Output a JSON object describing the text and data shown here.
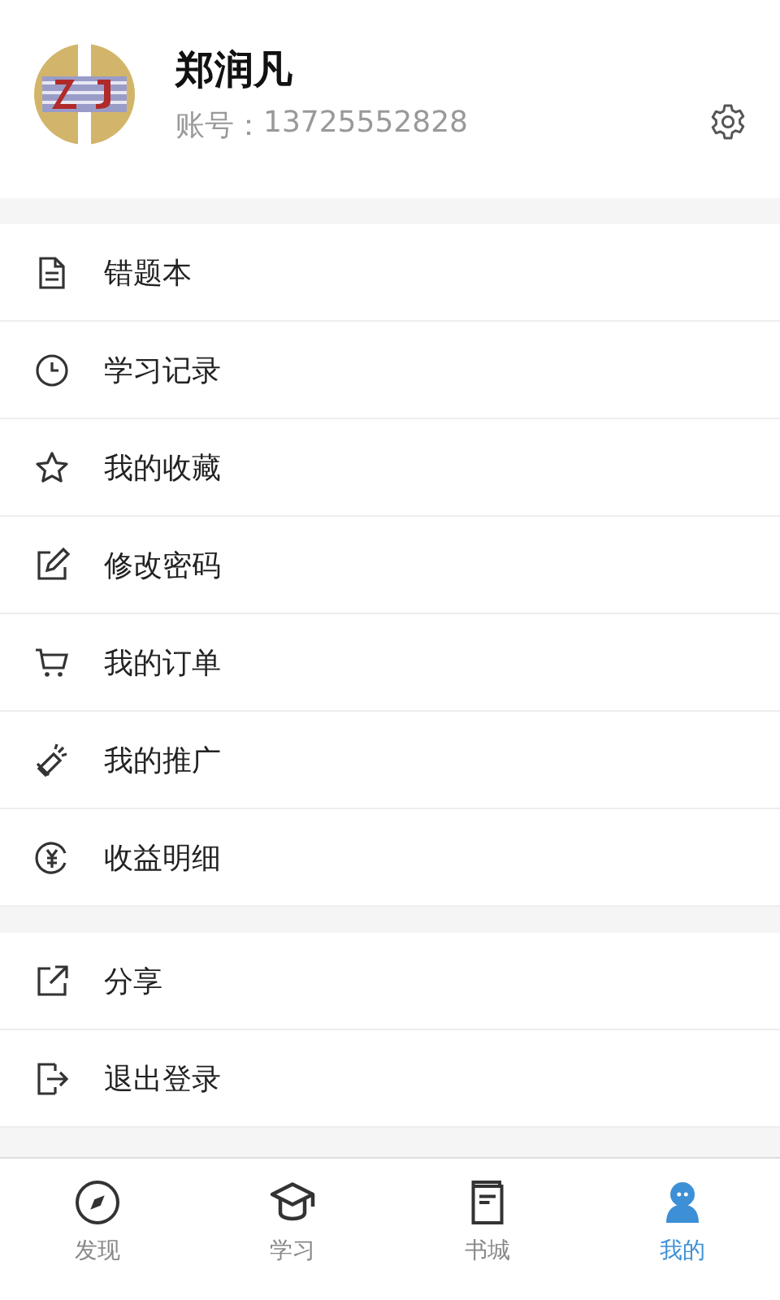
{
  "profile": {
    "name": "郑润凡",
    "account_label": "账号：",
    "account": "13725552828"
  },
  "menu_groups": [
    {
      "items": [
        {
          "kind": "notebook",
          "label": "错题本"
        },
        {
          "kind": "clock",
          "label": "学习记录"
        },
        {
          "kind": "star",
          "label": "我的收藏"
        },
        {
          "kind": "edit",
          "label": "修改密码"
        },
        {
          "kind": "cart",
          "label": "我的订单"
        },
        {
          "kind": "megaphone",
          "label": "我的推广"
        },
        {
          "kind": "yuan",
          "label": "收益明细"
        }
      ]
    },
    {
      "items": [
        {
          "kind": "share",
          "label": "分享"
        },
        {
          "kind": "logout",
          "label": "退出登录"
        }
      ]
    }
  ],
  "tab_bar": [
    {
      "kind": "compass",
      "label": "发现",
      "selected": false
    },
    {
      "kind": "cap",
      "label": "学习",
      "selected": false
    },
    {
      "kind": "book",
      "label": "书城",
      "selected": false
    },
    {
      "kind": "person",
      "label": "我的",
      "selected": true
    }
  ]
}
